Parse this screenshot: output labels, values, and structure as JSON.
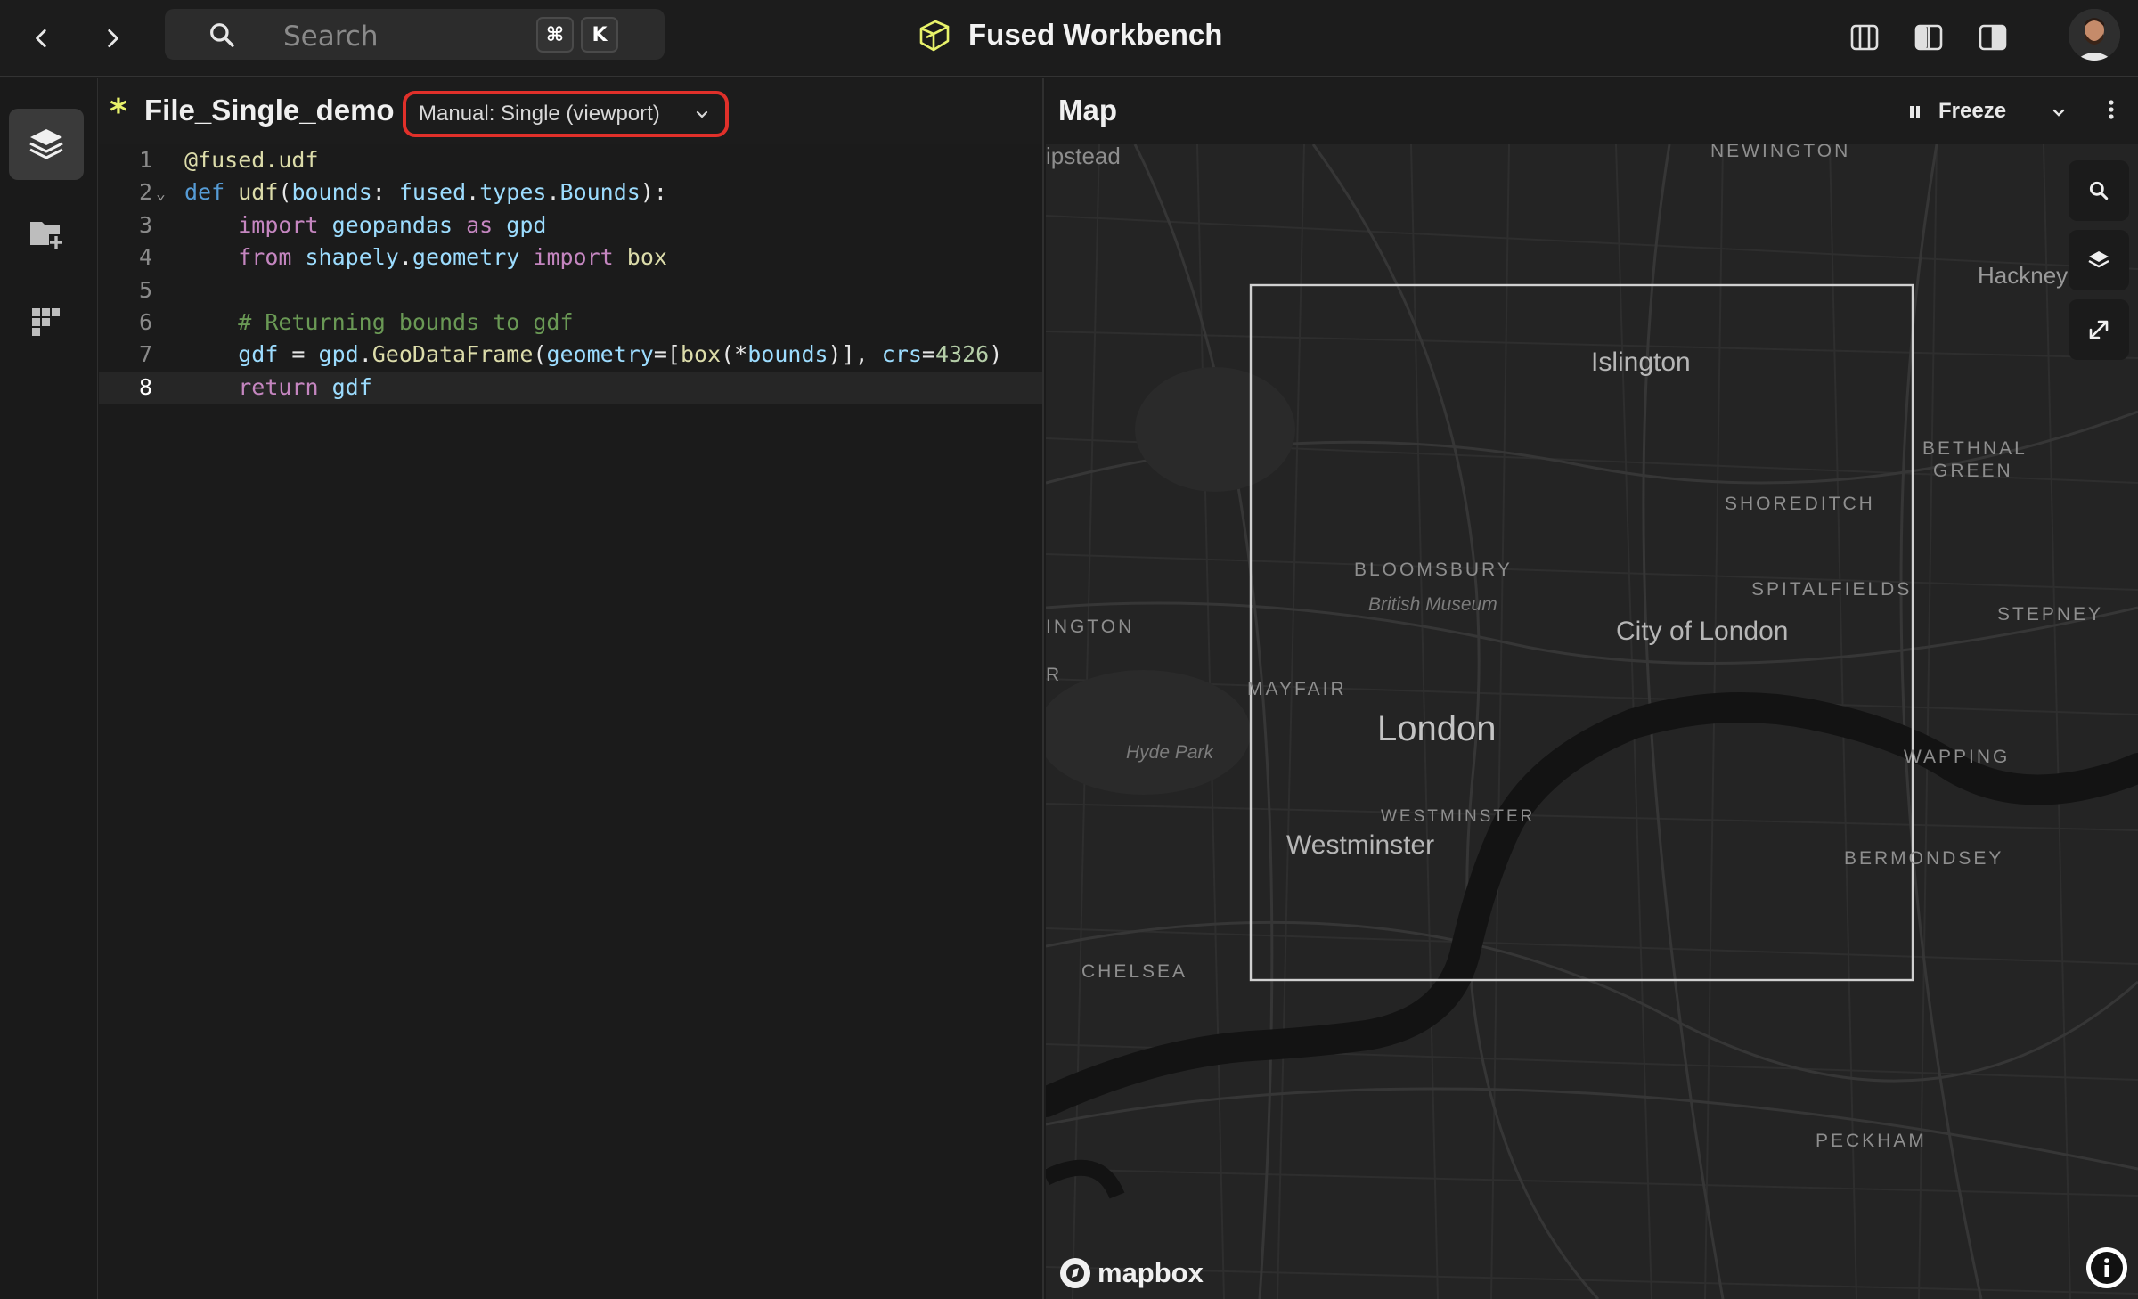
{
  "app": {
    "title": "Fused Workbench"
  },
  "search": {
    "placeholder": "Search",
    "shortcut_mod": "⌘",
    "shortcut_key": "K"
  },
  "editor": {
    "file_name": "File_Single_demo",
    "unsaved_marker": "*",
    "execution_mode": "Manual: Single (viewport)",
    "current_line": 8,
    "lines": [
      "@fused.udf",
      "def udf(bounds: fused.types.Bounds):",
      "    import geopandas as gpd",
      "    from shapely.geometry import box",
      "",
      "    # Returning bounds to gdf",
      "    gdf = gpd.GeoDataFrame(geometry=[box(*bounds)], crs=4326)",
      "    return gdf"
    ]
  },
  "map": {
    "title": "Map",
    "freeze_label": "Freeze",
    "attribution": "mapbox",
    "places": {
      "hampstead": "ipstead",
      "newington": "NEWINGTON",
      "hackney": "Hackney",
      "islington": "Islington",
      "bethnal_green_1": "BETHNAL",
      "bethnal_green_2": "GREEN",
      "shoreditch": "SHOREDITCH",
      "bloomsbury": "BLOOMSBURY",
      "british_museum": "British Museum",
      "spitalfields": "SPITALFIELDS",
      "stepney": "STEPNEY",
      "kensington": "INGTON",
      "r_fragment": "R",
      "city_of_london": "City of London",
      "mayfair": "MAYFAIR",
      "london": "London",
      "hyde_park": "Hyde Park",
      "wapping": "WAPPING",
      "westminster_district": "WESTMINSTER",
      "westminster": "Westminster",
      "bermondsey": "BERMONDSEY",
      "chelsea": "CHELSEA",
      "peckham": "PECKHAM"
    }
  },
  "icons": {
    "back": "chevron-left-icon",
    "forward": "chevron-right-icon",
    "search": "search-icon",
    "layers": "layers-icon",
    "add_folder": "folder-plus-icon",
    "apps": "grid-icon",
    "pause": "pause-icon",
    "more": "more-vertical-icon",
    "map_search": "search-icon",
    "map_layers": "layers-icon",
    "expand": "expand-icon",
    "info": "info-icon"
  },
  "colors": {
    "accent_yellow": "#e8f26a",
    "highlight_red": "#e0302a",
    "bbox_outline": "#d0d0d0"
  }
}
